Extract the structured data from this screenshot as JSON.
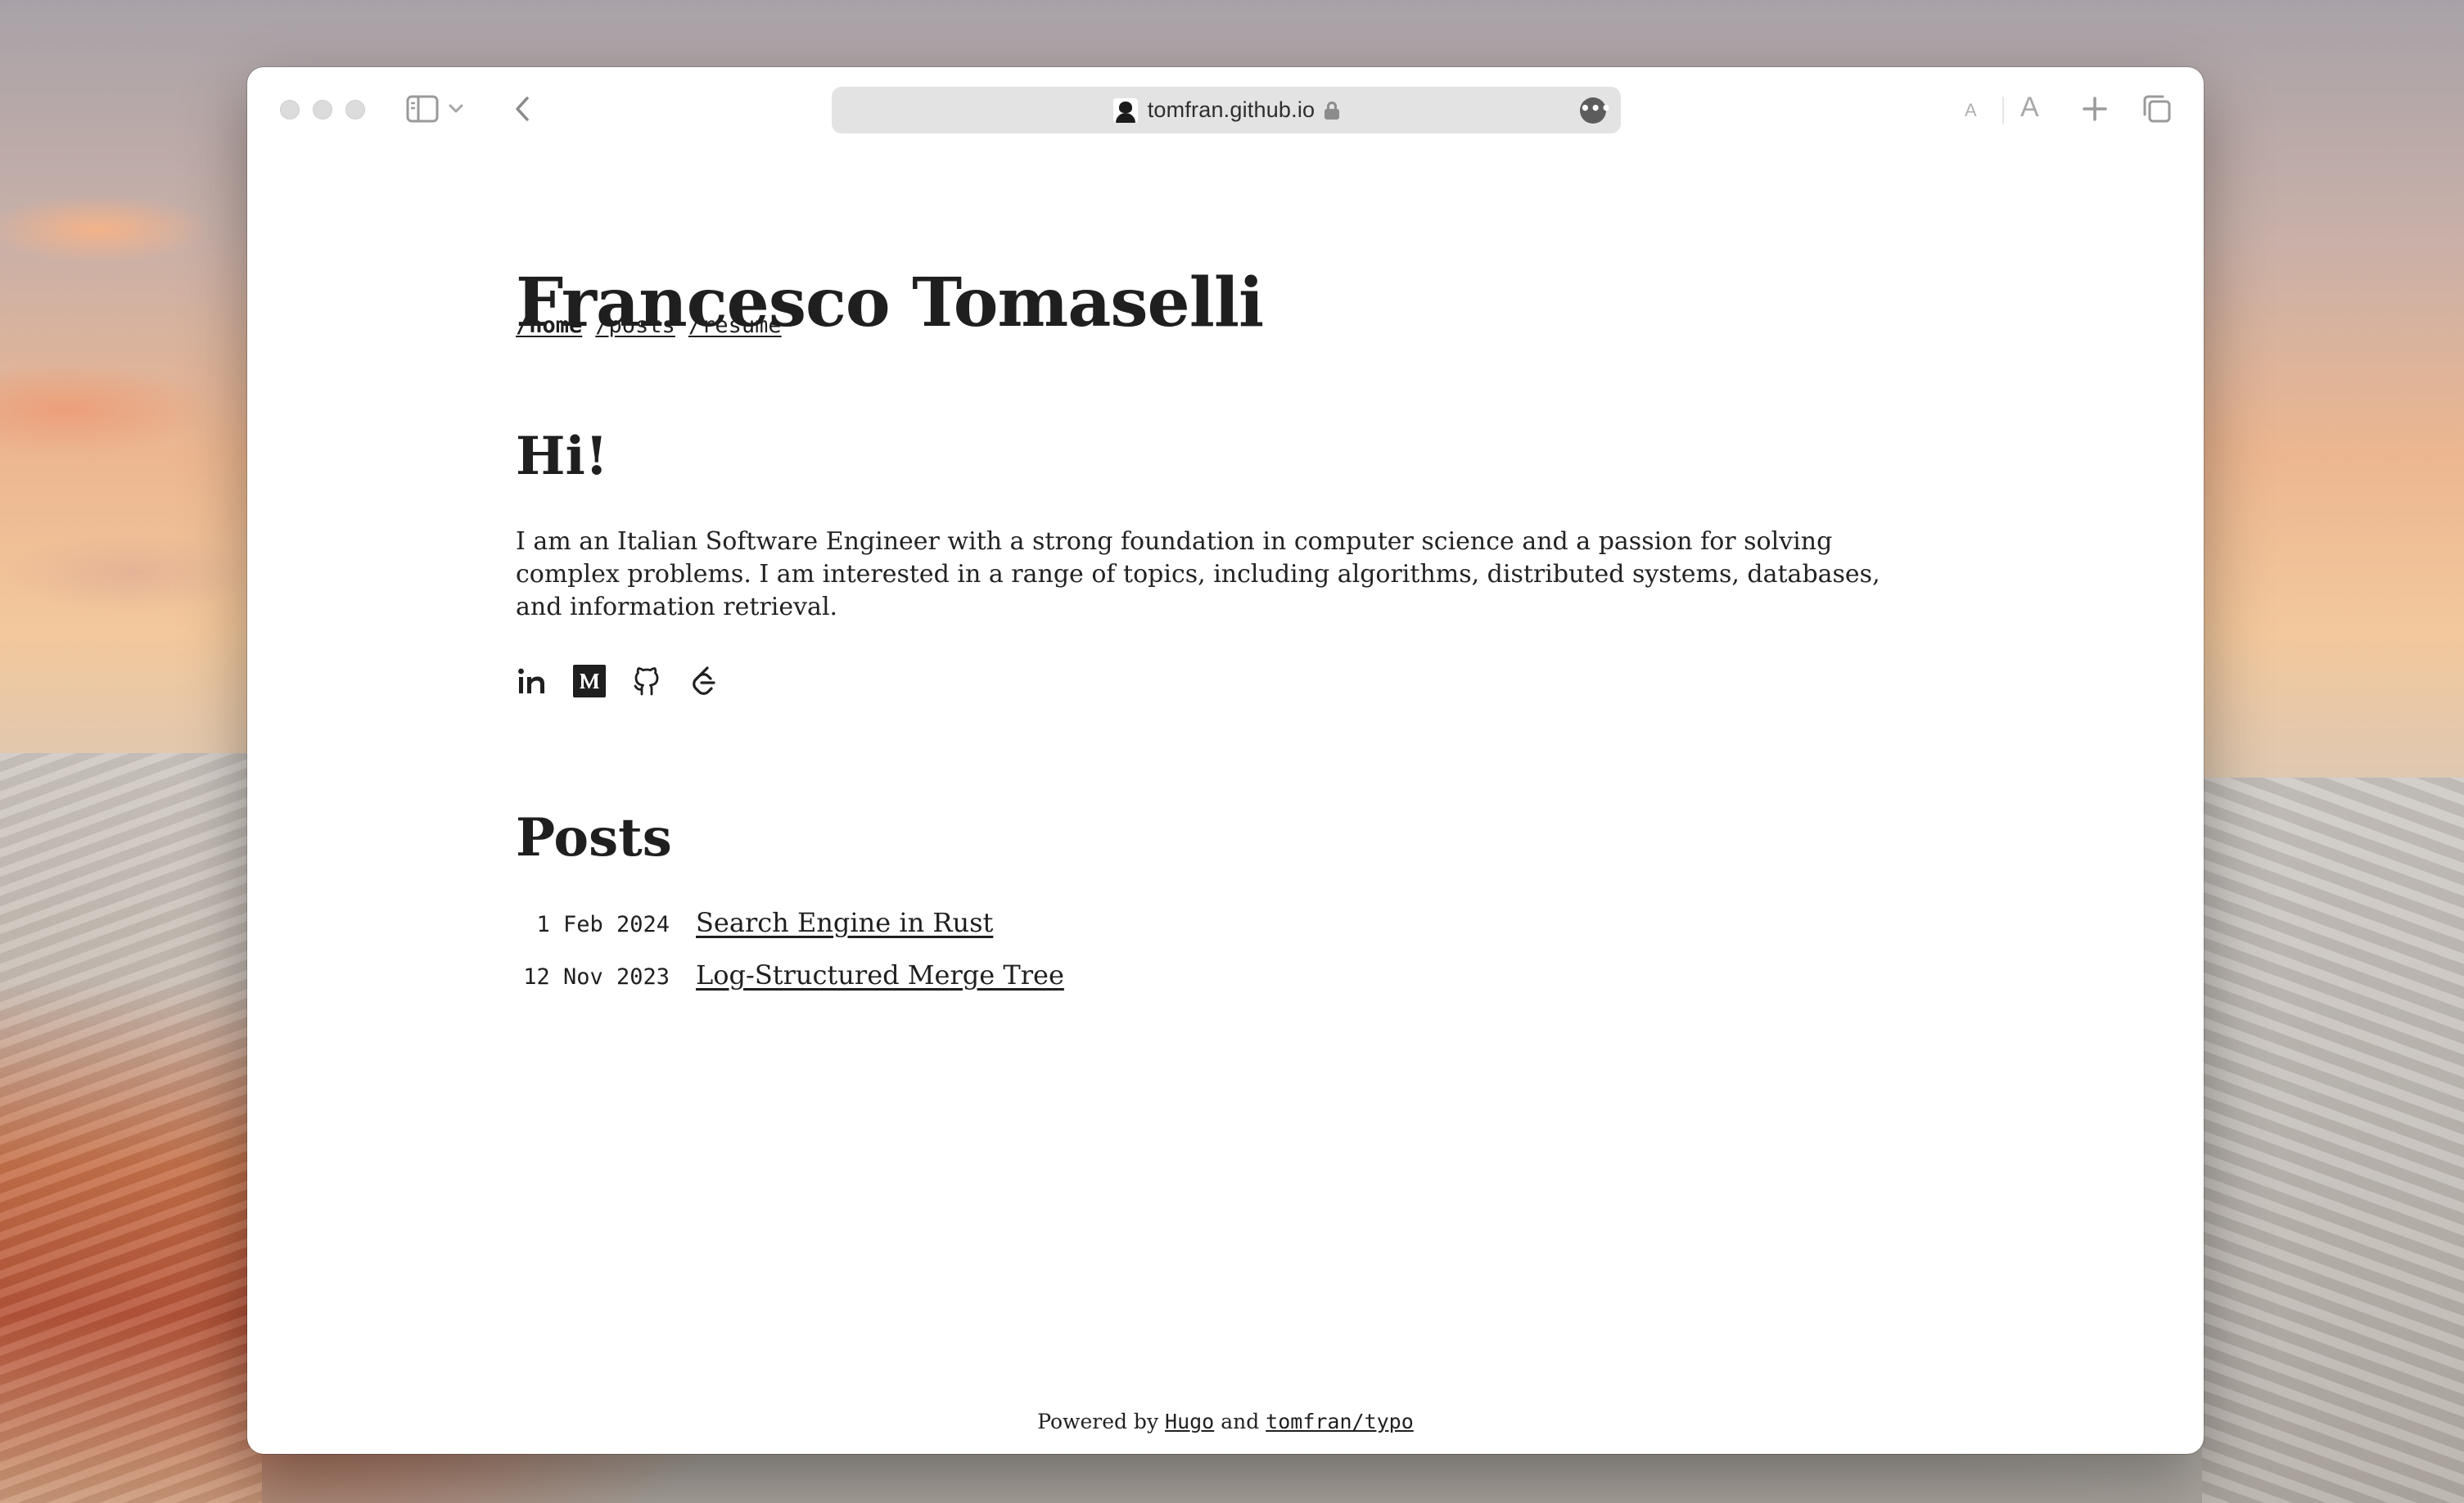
{
  "browser": {
    "url": "tomfran.github.io",
    "font_small_label": "A",
    "font_large_label": "A",
    "more_label": "•••"
  },
  "site": {
    "title": "Francesco Tomaselli",
    "nav": [
      {
        "label": "/home",
        "active": true
      },
      {
        "label": "/posts",
        "active": false
      },
      {
        "label": "/resume",
        "active": false
      }
    ]
  },
  "intro": {
    "heading": "Hi!",
    "text": "I am an Italian Software Engineer with a strong foundation in computer science and a passion for solving complex problems. I am interested in a range of topics, including algorithms, distributed systems, databases, and information retrieval."
  },
  "social": [
    "linkedin-icon",
    "medium-icon",
    "github-icon",
    "leetcode-icon"
  ],
  "posts": {
    "heading": "Posts",
    "items": [
      {
        "date": " 1 Feb 2024",
        "title": "Search Engine in Rust"
      },
      {
        "date": "12 Nov 2023",
        "title": "Log-Structured Merge Tree"
      }
    ]
  },
  "footer": {
    "powered_by": "Powered by",
    "hugo": "Hugo",
    "and": "and",
    "theme": "tomfran/typo"
  }
}
